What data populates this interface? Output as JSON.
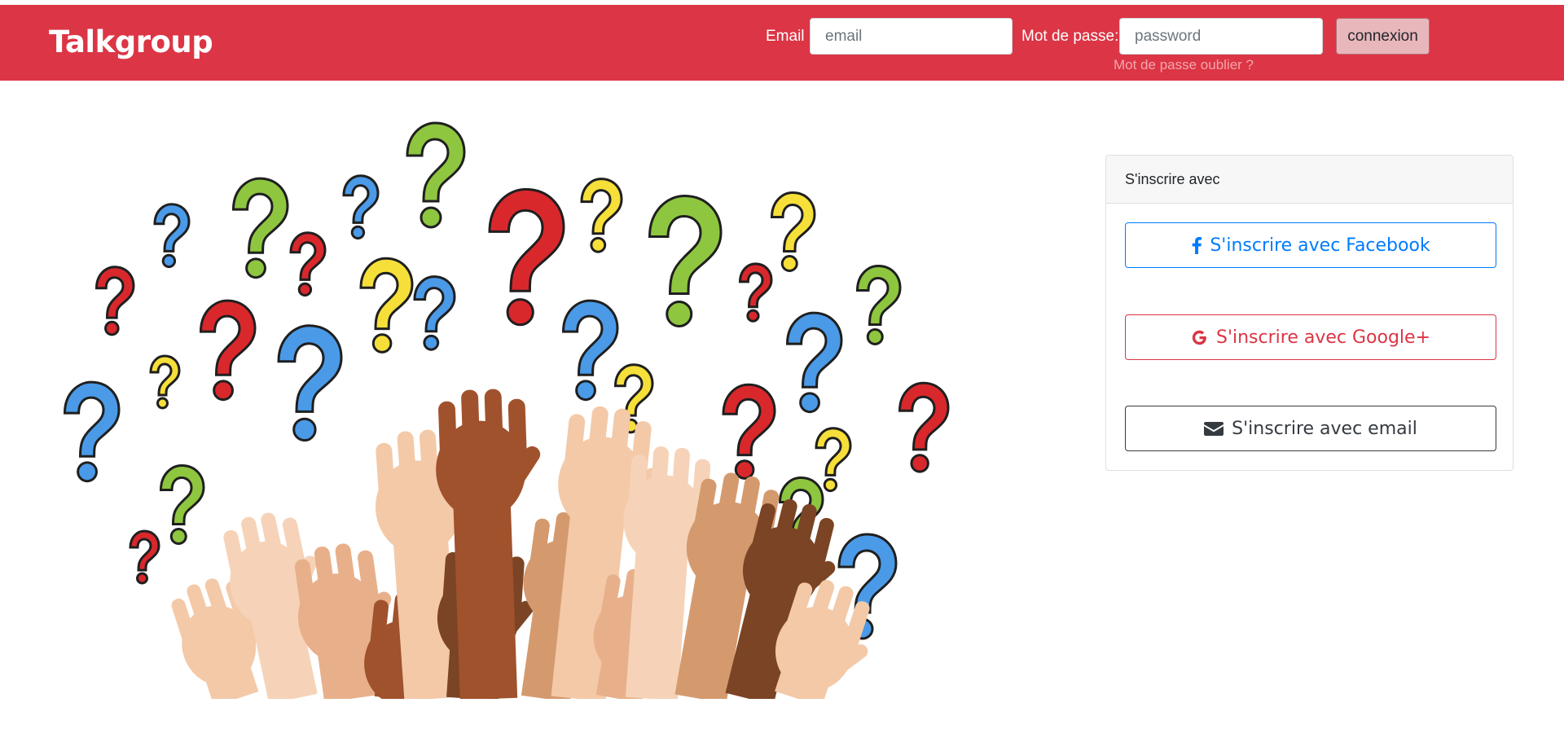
{
  "navbar": {
    "brand": "Talkgroup",
    "email_label": "Email :",
    "email_placeholder": "email",
    "password_label": "Mot de passe:",
    "password_placeholder": "password",
    "connect_label": "connexion",
    "forgot_label": "Mot de passe oublier ?"
  },
  "hero": {
    "image": "raised-hands-question-marks-illustration"
  },
  "signup": {
    "header": "S'inscrire avec",
    "facebook_label": "S'inscrire avec Facebook",
    "google_label": "S'inscrire avec Google+",
    "email_label": "S'inscrire avec email",
    "icons": [
      "facebook-icon",
      "google-icon",
      "envelope-icon"
    ]
  },
  "colors": {
    "navbar": "#dc3545",
    "facebook": "#007bff",
    "google": "#dc3545",
    "email": "#343a40"
  }
}
